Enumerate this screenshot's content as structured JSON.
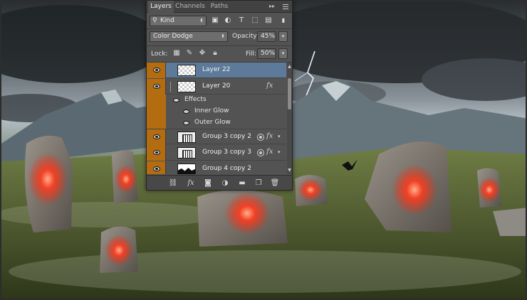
{
  "panel": {
    "tabs": [
      {
        "label": "Layers"
      },
      {
        "label": "Channels"
      },
      {
        "label": "Paths"
      }
    ],
    "collapse_glyph": "▸▸",
    "filter": {
      "kind": "Kind",
      "icons": [
        "image-filter-icon",
        "adjustment-filter-icon",
        "type-filter-icon",
        "shape-filter-icon",
        "smart-object-filter-icon"
      ]
    },
    "blend_mode": "Color Dodge",
    "opacity_label": "Opacity:",
    "opacity_value": "45%",
    "lock_label": "Lock:",
    "fill_label": "Fill:",
    "fill_value": "50%",
    "layers": [
      {
        "name": "Layer 22",
        "selected": true,
        "visible": true
      },
      {
        "name": "Layer 20",
        "visible": true,
        "has_fx": true
      },
      {
        "name": "Group 3 copy 2",
        "visible": true,
        "has_fx": true
      },
      {
        "name": "Group 3 copy 3",
        "visible": true,
        "has_fx": true
      },
      {
        "name": "Group 4 copy 2",
        "visible": true
      }
    ],
    "effects": {
      "header": "Effects",
      "items": [
        "Inner Glow",
        "Outer Glow"
      ]
    },
    "fx_glyph": "fx",
    "footer_icons": [
      "link-layers-icon",
      "add-style-icon",
      "add-mask-icon",
      "adjustment-layer-icon",
      "new-group-icon",
      "new-layer-icon",
      "delete-layer-icon"
    ]
  },
  "colors": {
    "panel_bg": "#535353",
    "eye_column": "#b46c10",
    "selection": "#5d7a9a",
    "rune_glow": "#ff3b1e"
  }
}
